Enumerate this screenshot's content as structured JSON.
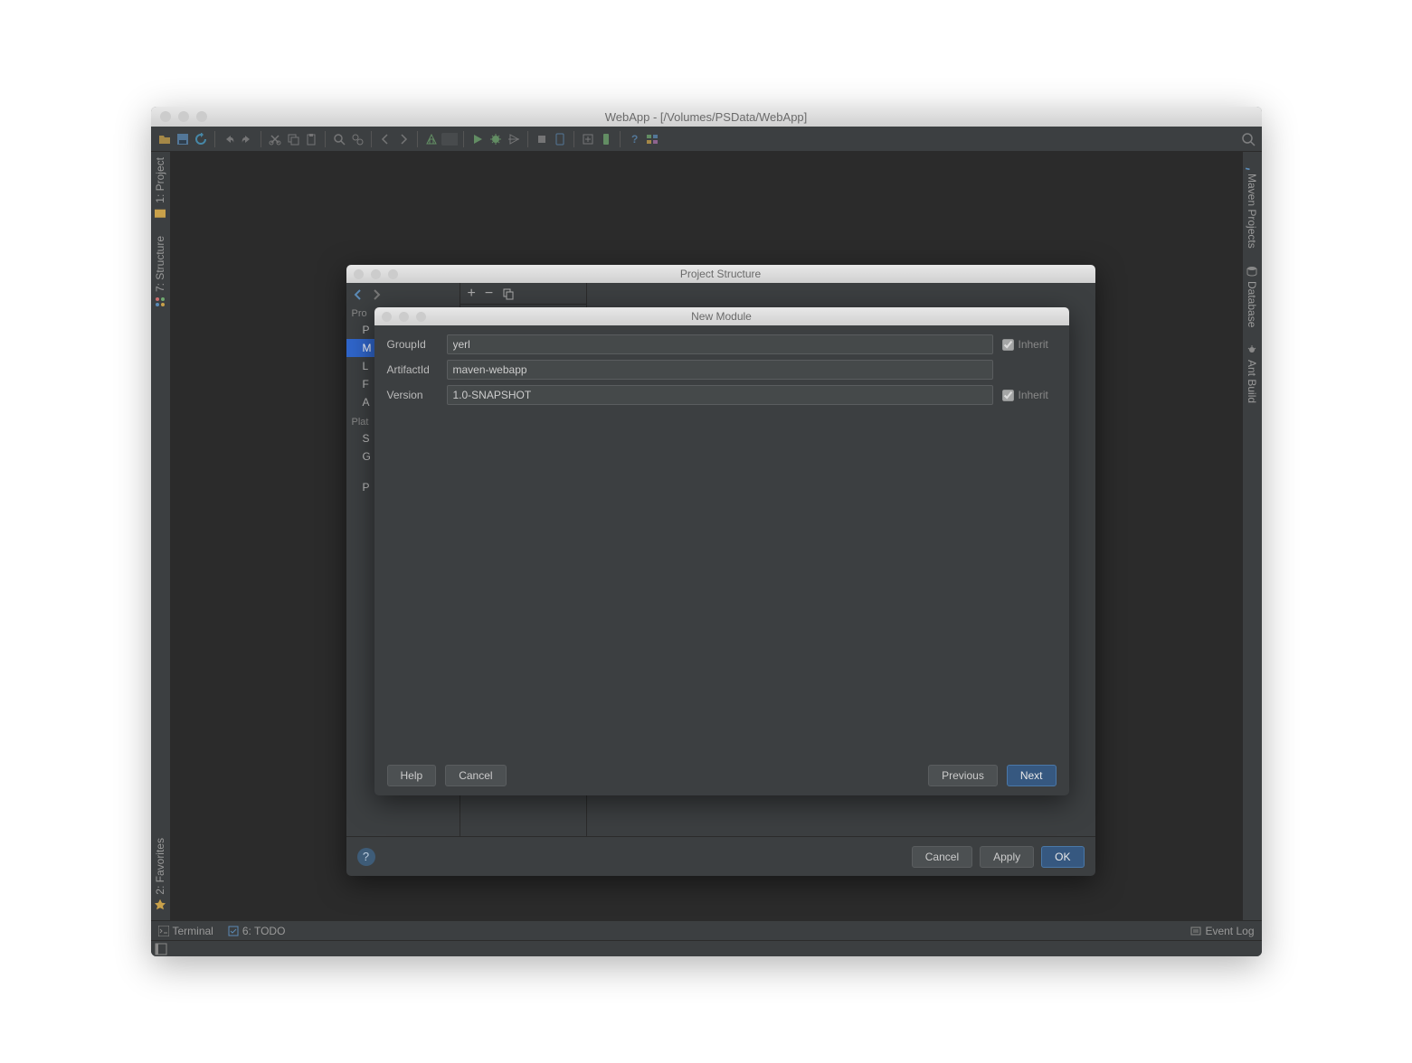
{
  "app": {
    "title": "WebApp - [/Volumes/PSData/WebApp]"
  },
  "left_gutter": {
    "project": "1: Project",
    "structure": "7: Structure",
    "favorites": "2: Favorites"
  },
  "right_gutter": {
    "maven": "Maven Projects",
    "database": "Database",
    "ant": "Ant Build"
  },
  "status": {
    "terminal": "Terminal",
    "todo": "6: TODO",
    "eventlog": "Event Log"
  },
  "ps_dialog": {
    "title": "Project Structure",
    "cat1": "Pro",
    "item_p": "P",
    "item_m": "M",
    "item_l": "L",
    "item_f": "F",
    "item_a": "A",
    "cat2": "Plat",
    "item_s": "S",
    "item_g": "G",
    "item_pr": "P",
    "cancel": "Cancel",
    "apply": "Apply",
    "ok": "OK"
  },
  "nm_dialog": {
    "title": "New Module",
    "groupid_label": "GroupId",
    "groupid_value": "yerl",
    "artifactid_label": "ArtifactId",
    "artifactid_value": "maven-webapp",
    "version_label": "Version",
    "version_value": "1.0-SNAPSHOT",
    "inherit": "Inherit",
    "help": "Help",
    "cancel": "Cancel",
    "previous": "Previous",
    "next": "Next"
  }
}
